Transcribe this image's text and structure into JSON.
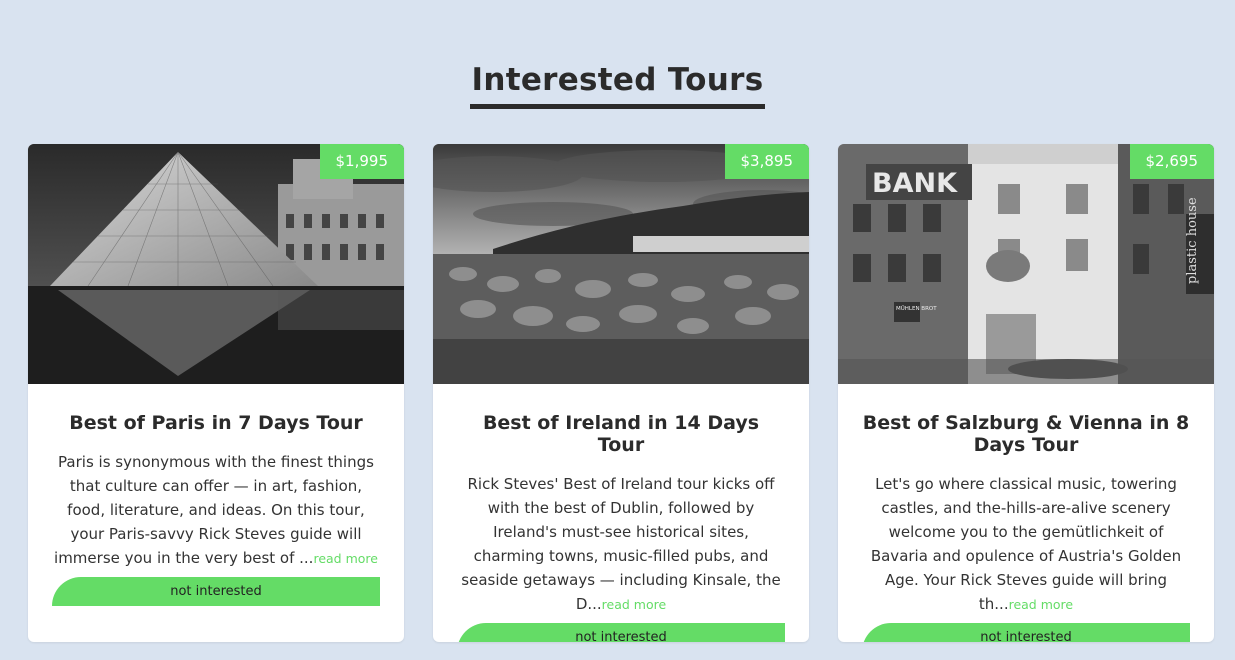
{
  "section": {
    "title": "Interested Tours"
  },
  "tours": [
    {
      "price": "$1,995",
      "title": "Best of Paris in 7 Days Tour",
      "description": "Paris is synonymous with the finest things that culture can offer — in art, fashion, food, literature, and ideas. On this tour, your Paris-savvy Rick Steves guide will immerse you in the very best of ...",
      "read_more": "read more",
      "button": "not interested",
      "image": "louvre-pyramid-photo"
    },
    {
      "price": "$3,895",
      "title": "Best of Ireland in 14 Days Tour",
      "description": "Rick Steves' Best of Ireland tour kicks off with the best of Dublin, followed by Ireland's must-see historical sites, charming towns, music-filled pubs, and seaside getaways — including Kinsale, the D...",
      "read_more": "read more",
      "button": "not interested",
      "image": "irish-coast-photo"
    },
    {
      "price": "$2,695",
      "title": "Best of Salzburg & Vienna in 8 Days Tour",
      "description": "Let's go where classical music, towering castles, and the-hills-are-alive scenery welcome you to the gemütlichkeit of Bavaria and opulence of Austria's Golden Age. Your Rick Steves guide will bring th...",
      "read_more": "read more",
      "button": "not interested",
      "image": "vienna-street-photo",
      "signs": {
        "bank": "BANK",
        "shop": "plastic house",
        "bakery": "MÜHLEN BROT"
      }
    }
  ],
  "colors": {
    "accent": "#64dc66",
    "background": "#d9e3f0",
    "text": "#2b2b2b"
  }
}
